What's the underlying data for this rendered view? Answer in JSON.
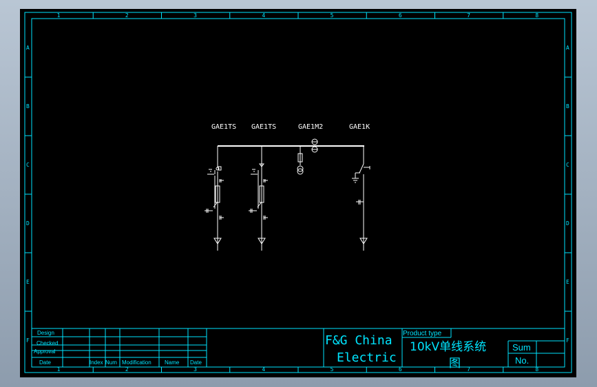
{
  "frame": {
    "columns": [
      "1",
      "2",
      "3",
      "4",
      "5",
      "6",
      "7",
      "8"
    ],
    "rows": [
      "A",
      "B",
      "C",
      "D",
      "E",
      "F"
    ]
  },
  "panels": [
    {
      "label": "GAE1TS"
    },
    {
      "label": "GAE1TS"
    },
    {
      "label": "GAE1M2"
    },
    {
      "label": "GAE1K"
    }
  ],
  "title_block": {
    "design": "Design",
    "checked": "Checked",
    "approval": "Approval",
    "date": "Date",
    "index": "Index",
    "num": "Num",
    "modification": "Modification",
    "name": "Name",
    "date2": "Date",
    "company_line1": "F&G China",
    "company_line2": "Electric",
    "product_type": "Product type",
    "title_line1": "10kV单线系统",
    "title_line2": "图",
    "sum": "Sum",
    "no": "No."
  },
  "colors": {
    "frame": "#00e5ff",
    "drawing": "#ffffff",
    "background": "#000000"
  }
}
